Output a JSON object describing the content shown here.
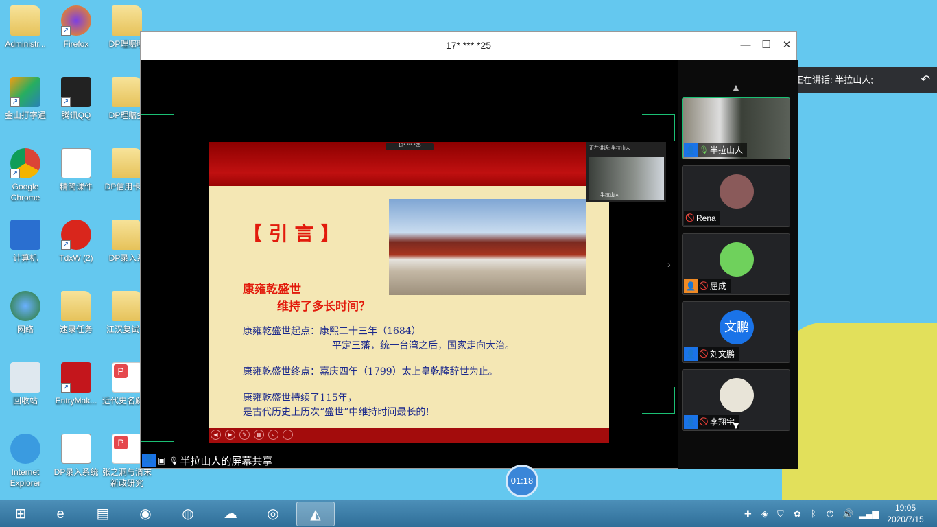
{
  "desktop": {
    "icons": [
      {
        "label": "Administr...",
        "type": "folder"
      },
      {
        "label": "金山打字通",
        "type": "app"
      },
      {
        "label": "Google Chrome",
        "type": "chrome"
      },
      {
        "label": "计算机",
        "type": "computer"
      },
      {
        "label": "网络",
        "type": "network"
      },
      {
        "label": "回收站",
        "type": "recycle"
      },
      {
        "label": "Internet Explorer",
        "type": "ie"
      },
      {
        "label": "Firefox",
        "type": "firefox"
      },
      {
        "label": "腾讯QQ",
        "type": "qq"
      },
      {
        "label": "精简课件",
        "type": "doc"
      },
      {
        "label": "TdxW (2)",
        "type": "tdx"
      },
      {
        "label": "速录任务",
        "type": "folder"
      },
      {
        "label": "EntryMak...",
        "type": "entry"
      },
      {
        "label": "DP录入系统",
        "type": "doc"
      },
      {
        "label": "DP理赔明",
        "type": "folder"
      },
      {
        "label": "DP理赔金",
        "type": "folder"
      },
      {
        "label": "DP信用卡础",
        "type": "folder"
      },
      {
        "label": "DP录入系",
        "type": "folder"
      },
      {
        "label": "江汉复试件",
        "type": "folder"
      },
      {
        "label": "近代史名解释",
        "type": "pdf"
      },
      {
        "label": "张之洞与清末新政研究",
        "type": "pdf"
      }
    ]
  },
  "window": {
    "title": "17* *** *25",
    "minimize": "—",
    "maximize": "☐",
    "close": "✕"
  },
  "slide": {
    "toolbar_title": "17* *** *25",
    "heading": "【 引 言 】",
    "question_line1": "康雍乾盛世",
    "question_line2": "维持了多长时间？",
    "start_line1": "康雍乾盛世起点：康熙二十三年（1684）",
    "start_line2": "平定三藩，统一台湾之后，国家走向大治。",
    "end_line": "康雍乾盛世终点：嘉庆四年（1799）太上皇乾隆辞世为止。",
    "duration_line1": "康雍乾盛世持续了115年，",
    "duration_line2": "是古代历史上历次“盛世”中维持时间最长的!",
    "mini_speaking": "正在讲话: 半拉山人",
    "mini_name": "半拉山人"
  },
  "share_label": "半拉山人的屏幕共享",
  "participants": [
    {
      "name": "半拉山人",
      "mic": "on",
      "badge": "#1a73e8",
      "avatar": "video"
    },
    {
      "name": "Rena",
      "mic": "muted",
      "badge": "",
      "avatar": "#8a5a5a"
    },
    {
      "name": "屈成",
      "mic": "muted",
      "badge": "#f08a24",
      "avatar": "#6fd15c"
    },
    {
      "name": "刘文鹏",
      "mic": "muted",
      "badge": "#1a73e8",
      "avatar": "#1a73e8",
      "avatar_text": "文鹏"
    },
    {
      "name": "李翔宇",
      "mic": "muted",
      "badge": "#1a73e8",
      "avatar": "#e8e4d8"
    }
  ],
  "speaking_banner": "正在讲话: 半拉山人;",
  "timer": "01:18",
  "taskbar": {
    "apps": [
      "start",
      "internet-explorer",
      "file-explorer",
      "netease-music",
      "firefox",
      "baidu-netdisk",
      "chrome",
      "meeting-app"
    ],
    "time": "19:05",
    "date": "2020/7/15"
  }
}
